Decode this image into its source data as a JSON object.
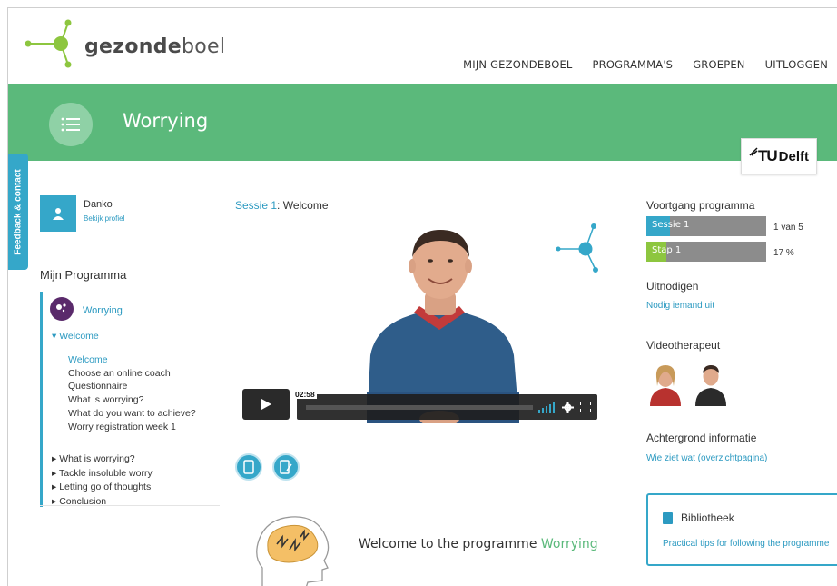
{
  "header": {
    "logo_prefix": "gezonde",
    "logo_suffix": "boel",
    "nav": [
      "MIJN GEZONDEBOEL",
      "PROGRAMMA'S",
      "GROEPEN",
      "UITLOGGEN"
    ]
  },
  "banner": {
    "title": "Worrying",
    "partner_logo_text": "Delft",
    "partner_logo_prefix": "TU"
  },
  "feedback_tab": "Feedback & contact",
  "profile": {
    "name": "Danko",
    "link": "Bekijk profiel"
  },
  "program": {
    "heading": "Mijn Programma",
    "name": "Worrying",
    "current_week": "Welcome",
    "current_items": [
      {
        "label": "Welcome",
        "active": true
      },
      {
        "label": "Choose an online coach",
        "active": false
      },
      {
        "label": "Questionnaire",
        "active": false
      },
      {
        "label": "What is worrying?",
        "active": false
      },
      {
        "label": "What do you want to achieve?",
        "active": false
      },
      {
        "label": "Worry registration week 1",
        "active": false
      }
    ],
    "other_weeks": [
      "What is worrying?",
      "Tackle insoluble worry",
      "Letting go of thoughts",
      "Conclusion"
    ]
  },
  "session": {
    "prefix": "Sessie ",
    "number": "1",
    "title": ": Welcome"
  },
  "video": {
    "time": "02:58"
  },
  "welcome": {
    "text": "Welcome to the programme ",
    "highlight": "Worrying"
  },
  "progress": {
    "heading": "Voortgang programma",
    "bars": [
      {
        "label": "Sessie 1",
        "value_text": "1 van 5",
        "fraction": 0.2,
        "color": "#35a7c9"
      },
      {
        "label": "Stap 1",
        "value_text": "17 %",
        "fraction": 0.17,
        "color": "#8dc63f"
      }
    ]
  },
  "invite": {
    "heading": "Uitnodigen",
    "link": "Nodig iemand uit"
  },
  "videotherapist": {
    "heading": "Videotherapeut"
  },
  "background": {
    "heading": "Achtergrond informatie",
    "link": "Wie ziet wat (overzichtpagina)"
  },
  "library": {
    "title": "Bibliotheek",
    "link": "Practical tips for following the programme"
  },
  "colors": {
    "green": "#5bb97b",
    "blue": "#35a7c9",
    "link": "#2c9ac1"
  }
}
